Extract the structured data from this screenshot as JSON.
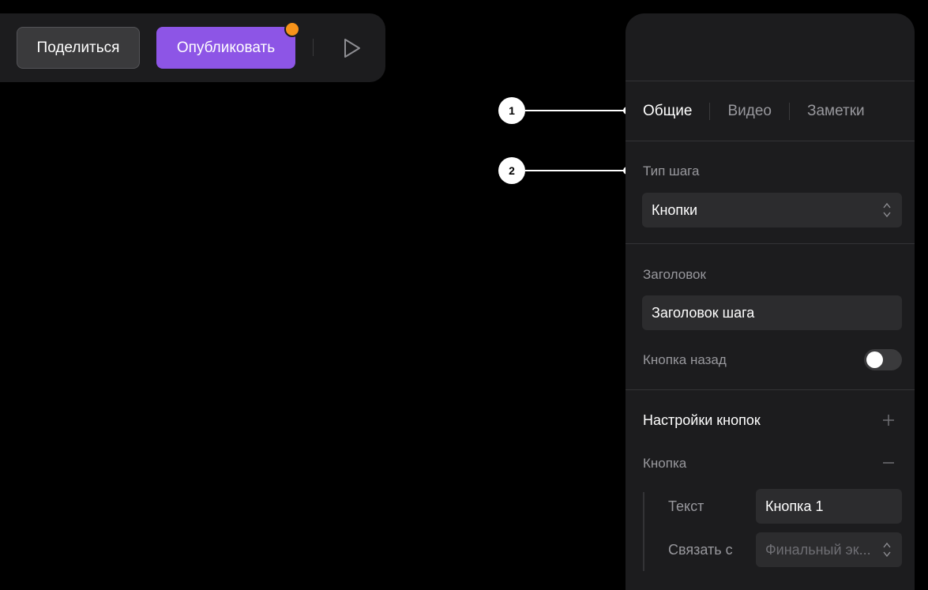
{
  "toolbar": {
    "share_label": "Поделиться",
    "publish_label": "Опубликовать",
    "notify_color": "#f7931a",
    "publish_color": "#8d55e6",
    "play_icon": "play-icon"
  },
  "callouts": [
    {
      "number": "1"
    },
    {
      "number": "2"
    }
  ],
  "panel": {
    "tabs": [
      {
        "label": "Общие",
        "active": true
      },
      {
        "label": "Видео",
        "active": false
      },
      {
        "label": "Заметки",
        "active": false
      }
    ],
    "step_type": {
      "label": "Тип шага",
      "value": "Кнопки",
      "icon": "select-arrows-icon"
    },
    "title": {
      "label": "Заголовок",
      "value": "Заголовок шага"
    },
    "back_button": {
      "label": "Кнопка назад",
      "enabled": false
    },
    "button_settings": {
      "label": "Настройки кнопок",
      "icon": "plus-icon"
    },
    "button": {
      "label": "Кнопка",
      "icon": "minus-icon",
      "text_label": "Текст",
      "text_value": "Кнопка 1",
      "link_label": "Связать с",
      "link_placeholder": "Финальный эк..."
    }
  }
}
